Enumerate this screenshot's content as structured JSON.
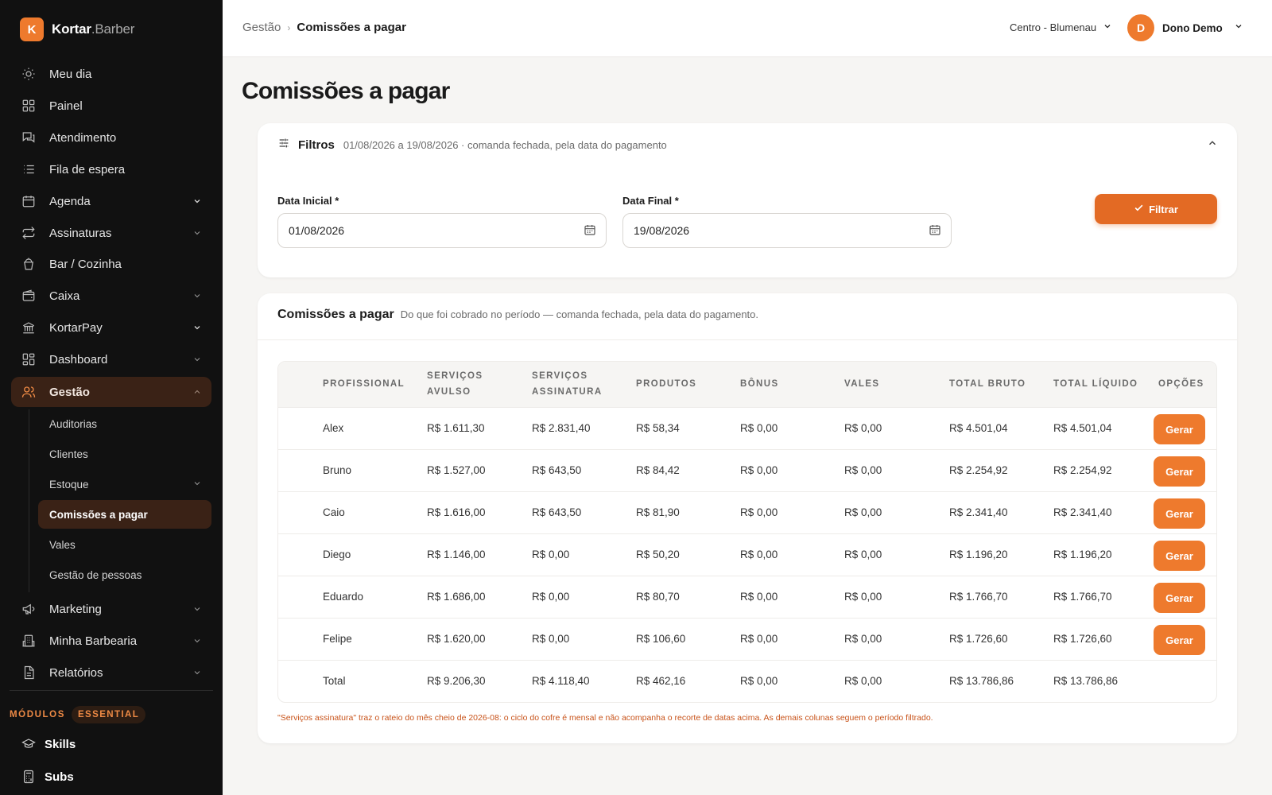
{
  "sidebar": {
    "brand_letter": "K",
    "brand_name": "Kortar",
    "brand_suffix": ".Barber",
    "items": [
      {
        "label": "Meu dia",
        "icon": "sun-icon"
      },
      {
        "label": "Painel",
        "icon": "grid-icon"
      },
      {
        "label": "Atendimento",
        "icon": "chat-icon"
      },
      {
        "label": "Fila de espera",
        "icon": "list-icon"
      },
      {
        "label": "Agenda",
        "icon": "calendar-icon"
      },
      {
        "label": "Assinaturas",
        "icon": "repeat-icon"
      },
      {
        "label": "Bar / Cozinha",
        "icon": "cup-icon"
      },
      {
        "label": "Caixa",
        "icon": "wallet-icon"
      },
      {
        "label": "KortarPay",
        "icon": "bank-icon"
      },
      {
        "label": "Dashboard",
        "icon": "dashboard-icon"
      },
      {
        "label": "Gestão",
        "icon": "users-icon"
      },
      {
        "label": "Marketing",
        "icon": "megaphone-icon"
      },
      {
        "label": "Minha Barbearia",
        "icon": "building-icon"
      },
      {
        "label": "Relatórios",
        "icon": "report-icon"
      }
    ],
    "sub_items": [
      {
        "label": "Auditorias"
      },
      {
        "label": "Clientes"
      },
      {
        "label": "Estoque"
      },
      {
        "label": "Comissões a pagar"
      },
      {
        "label": "Vales"
      },
      {
        "label": "Gestão de pessoas"
      }
    ],
    "modules_label": "MÓDULOS",
    "modules_badge": "ESSENTIAL",
    "modules": [
      {
        "label": "Skills",
        "icon": "graduation-icon"
      },
      {
        "label": "Subs",
        "icon": "calculator-icon"
      }
    ]
  },
  "topbar": {
    "crumb_parent": "Gestão",
    "crumb_current": "Comissões a pagar",
    "branch": "Centro - Blumenau",
    "user_initial": "D",
    "user_name": "Dono Demo"
  },
  "page": {
    "title": "Comissões a pagar"
  },
  "filters": {
    "title": "Filtros",
    "summary": "01/08/2026 a 19/08/2026 · comanda fechada, pela data do pagamento",
    "start_label": "Data Inicial *",
    "start_value": "01/08/2026",
    "end_label": "Data Final *",
    "end_value": "19/08/2026",
    "button_label": "Filtrar"
  },
  "table": {
    "title": "Comissões a pagar",
    "subtitle": "Do que foi cobrado no período — comanda fechada, pela data do pagamento.",
    "headers": {
      "profissional": "PROFISSIONAL",
      "servicos_avulso": [
        "SERVIÇOS",
        "AVULSO"
      ],
      "servicos_assinatura": [
        "SERVIÇOS",
        "ASSINATURA"
      ],
      "produtos": "PRODUTOS",
      "bonus": "BÔNUS",
      "vales": "VALES",
      "total_bruto": "TOTAL BRUTO",
      "total_liquido": "TOTAL LÍQUIDO",
      "opcoes": "OPÇÕES"
    },
    "rows": [
      {
        "nome": "Alex",
        "avulso": "R$ 1.611,30",
        "assinatura": "R$ 2.831,40",
        "produtos": "R$ 58,34",
        "bonus": "R$ 0,00",
        "vales": "R$ 0,00",
        "bruto": "R$ 4.501,04",
        "liquido": "R$ 4.501,04",
        "acao": "Gerar"
      },
      {
        "nome": "Bruno",
        "avulso": "R$ 1.527,00",
        "assinatura": "R$ 643,50",
        "produtos": "R$ 84,42",
        "bonus": "R$ 0,00",
        "vales": "R$ 0,00",
        "bruto": "R$ 2.254,92",
        "liquido": "R$ 2.254,92",
        "acao": "Gerar"
      },
      {
        "nome": "Caio",
        "avulso": "R$ 1.616,00",
        "assinatura": "R$ 643,50",
        "produtos": "R$ 81,90",
        "bonus": "R$ 0,00",
        "vales": "R$ 0,00",
        "bruto": "R$ 2.341,40",
        "liquido": "R$ 2.341,40",
        "acao": "Gerar"
      },
      {
        "nome": "Diego",
        "avulso": "R$ 1.146,00",
        "assinatura": "R$ 0,00",
        "produtos": "R$ 50,20",
        "bonus": "R$ 0,00",
        "vales": "R$ 0,00",
        "bruto": "R$ 1.196,20",
        "liquido": "R$ 1.196,20",
        "acao": "Gerar"
      },
      {
        "nome": "Eduardo",
        "avulso": "R$ 1.686,00",
        "assinatura": "R$ 0,00",
        "produtos": "R$ 80,70",
        "bonus": "R$ 0,00",
        "vales": "R$ 0,00",
        "bruto": "R$ 1.766,70",
        "liquido": "R$ 1.766,70",
        "acao": "Gerar"
      },
      {
        "nome": "Felipe",
        "avulso": "R$ 1.620,00",
        "assinatura": "R$ 0,00",
        "produtos": "R$ 106,60",
        "bonus": "R$ 0,00",
        "vales": "R$ 0,00",
        "bruto": "R$ 1.726,60",
        "liquido": "R$ 1.726,60",
        "acao": "Gerar"
      }
    ],
    "total": {
      "nome": "Total",
      "avulso": "R$ 9.206,30",
      "assinatura": "R$ 4.118,40",
      "produtos": "R$ 462,16",
      "bonus": "R$ 0,00",
      "vales": "R$ 0,00",
      "bruto": "R$ 13.786,86",
      "liquido": "R$ 13.786,86"
    },
    "footnote": "\"Serviços assinatura\" traz o rateio do mês cheio de 2026-08: o ciclo do cofre é mensal e não acompanha o recorte de datas acima. As demais colunas seguem o período filtrado."
  },
  "colors": {
    "accent": "#ee7a2d",
    "accent_dark": "#e36a24",
    "sidebar_bg": "#111111",
    "sidebar_active": "#3a2216",
    "footnote": "#c8531a"
  }
}
